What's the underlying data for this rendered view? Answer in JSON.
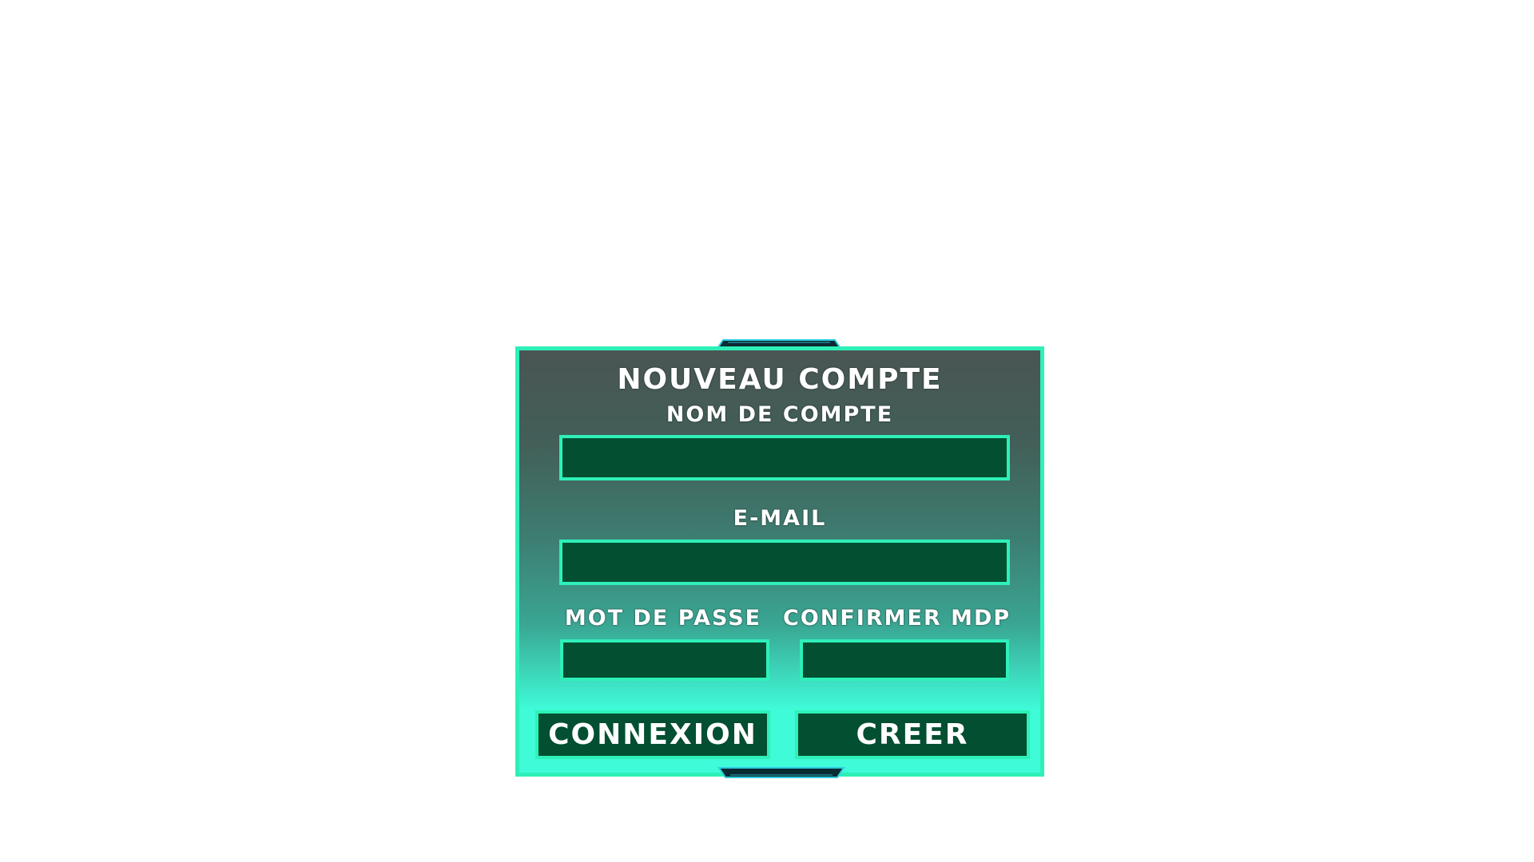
{
  "form": {
    "title": "NOUVEAU COMPTE",
    "account_name_label": "NOM DE COMPTE",
    "account_name_value": "",
    "email_label": "E-MAIL",
    "email_value": "",
    "password_label": "MOT DE PASSE",
    "password_value": "",
    "confirm_password_label": "CONFIRMER MDP",
    "confirm_password_value": ""
  },
  "buttons": {
    "login_label": "CONNEXION",
    "create_label": "CREER"
  },
  "colors": {
    "accent": "#2ef0b8",
    "field_bg": "#024f31",
    "panel_top": "#4a5553",
    "panel_bottom": "#3ffbd8",
    "tab": "#0b2b33",
    "text": "#ffffff"
  }
}
